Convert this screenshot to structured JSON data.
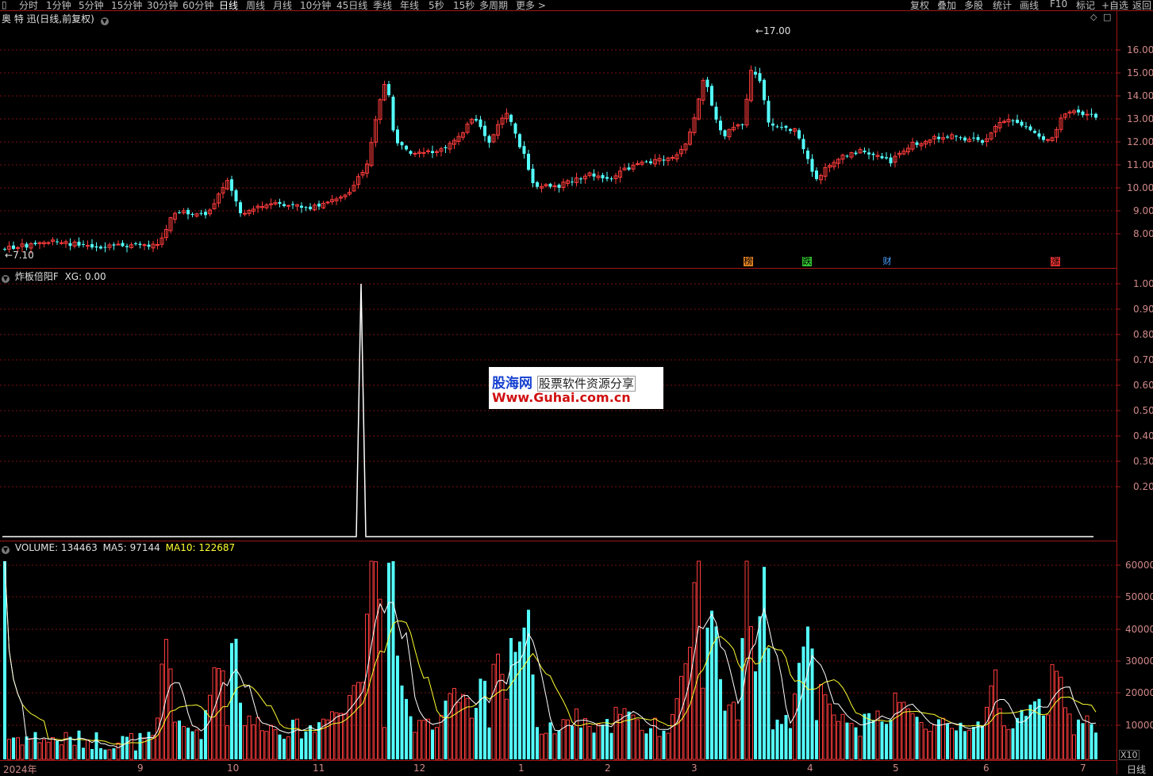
{
  "toolbar": {
    "periods": [
      "分时",
      "1分钟",
      "5分钟",
      "15分钟",
      "30分钟",
      "60分钟",
      "日线",
      "周线",
      "月线",
      "10分钟",
      "45日线",
      "季线",
      "年线",
      "5秒",
      "15秒",
      "多周期",
      "更多 >"
    ],
    "active_period": "日线",
    "right_buttons": [
      "复权",
      "叠加",
      "多股",
      "统计",
      "画线",
      "F10",
      "标记",
      "+自选",
      "返回"
    ]
  },
  "price_panel": {
    "title": "奥 特 迅(日线,前复权)",
    "axis_ticks": [
      "16.00",
      "15.00",
      "14.00",
      "13.00",
      "12.00",
      "11.00",
      "10.00",
      "9.00",
      "8.00"
    ],
    "high_label": "17.00",
    "low_label": "7.10",
    "markers": [
      {
        "text": "榜",
        "color": "#e08020"
      },
      {
        "text": "跌",
        "color": "#30c030"
      },
      {
        "text": "财",
        "color": "#4aa0ff"
      },
      {
        "text": "涨",
        "color": "#e03030"
      }
    ]
  },
  "indicator_panel": {
    "title_name": "炸板倍阳F",
    "title_value": "XG: 0.00",
    "axis_ticks": [
      "1.00",
      "0.90",
      "0.80",
      "0.70",
      "0.60",
      "0.50",
      "0.40",
      "0.30",
      "0.20"
    ]
  },
  "volume_panel": {
    "volume_text": "VOLUME: 134463",
    "ma5_text": "MA5: 97144",
    "ma10_text": "MA10: 122687",
    "axis_ticks": [
      "60000",
      "50000",
      "40000",
      "30000",
      "20000",
      "10000"
    ],
    "unit_label": "X10"
  },
  "date_axis": {
    "labels": [
      "2024年",
      "9",
      "10",
      "11",
      "12",
      "1",
      "2",
      "3",
      "4",
      "5",
      "6",
      "7"
    ],
    "period_label": "日线"
  },
  "watermark": {
    "line1_brand": "股海网",
    "line1_text": "股票软件资源分享",
    "line2": "Www.Guhai.com.cn"
  },
  "colors": {
    "up": "#ff3c3c",
    "down": "#54ffff",
    "grid": "#7a1010",
    "ma5": "#ffffff",
    "ma10": "#ffff30",
    "axis_text": "#d08888"
  }
}
